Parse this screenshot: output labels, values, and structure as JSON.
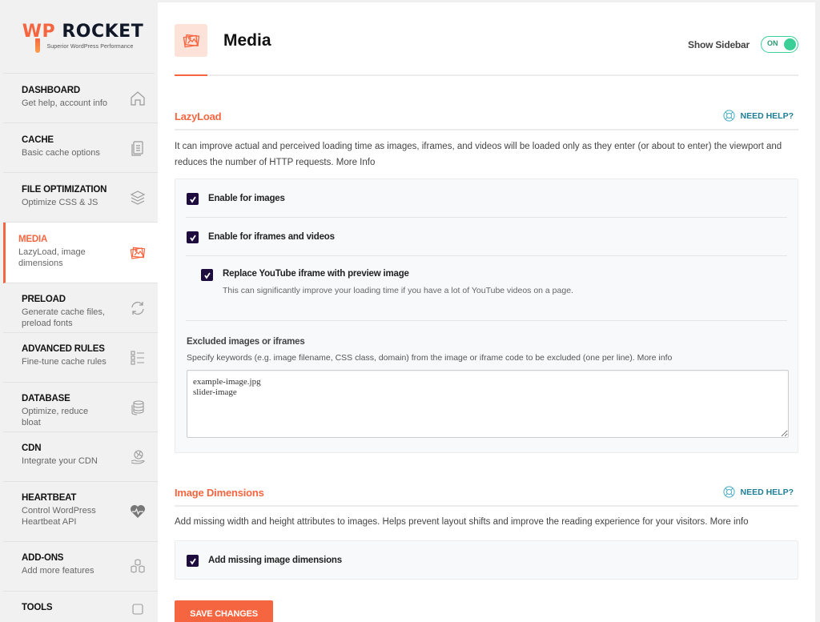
{
  "brand": {
    "logo_wp": "WP",
    "logo_rocket": "ROCKET",
    "tagline": "Superior WordPress Performance"
  },
  "sidebar": {
    "items": [
      {
        "title": "DASHBOARD",
        "desc": "Get help, account info",
        "icon": "home-icon"
      },
      {
        "title": "CACHE",
        "desc": "Basic cache options",
        "icon": "document-icon"
      },
      {
        "title": "FILE OPTIMIZATION",
        "desc": "Optimize CSS & JS",
        "icon": "layers-icon"
      },
      {
        "title": "MEDIA",
        "desc": "LazyLoad, image dimensions",
        "icon": "images-icon",
        "active": true
      },
      {
        "title": "PRELOAD",
        "desc": "Generate cache files, preload fonts",
        "icon": "refresh-icon"
      },
      {
        "title": "ADVANCED RULES",
        "desc": "Fine-tune cache rules",
        "icon": "checklist-icon"
      },
      {
        "title": "DATABASE",
        "desc": "Optimize, reduce bloat",
        "icon": "database-icon"
      },
      {
        "title": "CDN",
        "desc": "Integrate your CDN",
        "icon": "globe-hand-icon"
      },
      {
        "title": "HEARTBEAT",
        "desc": "Control WordPress Heartbeat API",
        "icon": "heartbeat-icon"
      },
      {
        "title": "ADD-ONS",
        "desc": "Add more features",
        "icon": "cubes-icon"
      },
      {
        "title": "TOOLS",
        "desc": "",
        "icon": "tools-icon"
      }
    ]
  },
  "header": {
    "title": "Media",
    "show_sidebar_label": "Show Sidebar",
    "toggle_state": "ON"
  },
  "lazyload": {
    "title": "LazyLoad",
    "need_help": "NEED HELP?",
    "description": "It can improve actual and perceived loading time as images, iframes, and videos will be loaded only as they enter (or about to enter) the viewport and reduces the number of HTTP requests. More Info",
    "options": {
      "images": {
        "label": "Enable for images",
        "checked": true
      },
      "iframes": {
        "label": "Enable for iframes and videos",
        "checked": true
      },
      "youtube": {
        "label": "Replace YouTube iframe with preview image",
        "desc": "This can significantly improve your loading time if you have a lot of YouTube videos on a page.",
        "checked": true
      }
    },
    "excluded": {
      "title": "Excluded images or iframes",
      "desc": "Specify keywords (e.g. image filename, CSS class, domain) from the image or iframe code to be excluded (one per line). More info",
      "value": "example-image.jpg\nslider-image"
    }
  },
  "image_dimensions": {
    "title": "Image Dimensions",
    "need_help": "NEED HELP?",
    "description": "Add missing width and height attributes to images. Helps prevent layout shifts and improve the reading experience for your visitors. More info",
    "option": {
      "label": "Add missing image dimensions",
      "checked": true
    }
  },
  "actions": {
    "save_label": "SAVE CHANGES"
  },
  "colors": {
    "accent": "#f56640",
    "toggle_on": "#3acf96",
    "help_link": "#1f7e94",
    "checkbox": "#1d0c3d"
  }
}
